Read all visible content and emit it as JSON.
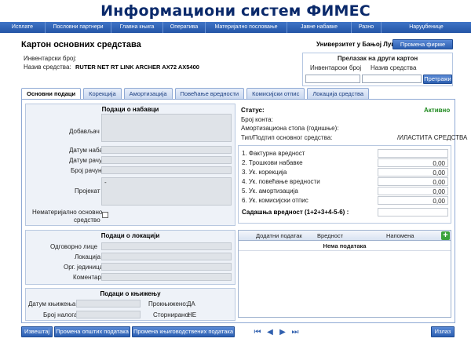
{
  "app": {
    "title": "Информациони систем ФИМЕС"
  },
  "menu": [
    "Исплате",
    "Пословни партнери",
    "Главна књига",
    "Оперативa",
    "Материјално пословање",
    "Јавне набавке",
    "Разно",
    "Наруџбенице"
  ],
  "page": {
    "title": "Картон основних средстава",
    "inventory_label": "Инвентарски број:",
    "inventory_value": "",
    "name_label": "Назив средства:",
    "name_value": "RUTER NET RT LINK ARCHER AX72 AX5400"
  },
  "firm": {
    "name": "Универзитет у Бањој Луци",
    "change_button": "Промена фирме"
  },
  "transfer": {
    "title": "Прелазак на други картон",
    "inv_label": "Инвентарски број",
    "name_label": "Назив средства",
    "inv_value": "",
    "name_value": "",
    "search_button": "Претражи"
  },
  "tabs": [
    "Основни подаци",
    "Корекција",
    "Амортизација",
    "Повећање вредности",
    "Комисијски отпис",
    "Локација средства"
  ],
  "acquisition": {
    "header": "Подаци о набавци",
    "supplier_label": "Добављач",
    "date_label": "Датум набавке",
    "invoice_date_label": "Датум рачуна",
    "invoice_no_label": "Број рачуна",
    "project_label": "Пројекат",
    "project_value": "-",
    "intangible_label_1": "Нематеријално основно",
    "intangible_label_2": "средство"
  },
  "location": {
    "header": "Подаци о локацији",
    "responsible_label": "Одговорно лице",
    "location_label": "Локација",
    "org_unit_label": "Орг. јединица",
    "comment_label": "Коментар"
  },
  "booking": {
    "header": "Подаци о књижењу",
    "date_label": "Датум књижења",
    "order_label": "Број налога",
    "booked_label": "Прокњижено:",
    "booked_value": "ДА",
    "cancelled_label": "Сторнирано:",
    "cancelled_value": "НЕ"
  },
  "status": {
    "status_label": "Статус:",
    "status_value": "Активно",
    "account_label": "Број конта:",
    "depreciation_label": "Амортизациона стопа (годишње):",
    "type_label": "Тип/Подтип основног средства:",
    "type_value": "/ИЛАСТИТА СРЕДСТВА"
  },
  "values": {
    "rows": [
      {
        "label": "1. Фактурна вредност",
        "value": ""
      },
      {
        "label": "2. Трошкови набавке",
        "value": "0,00"
      },
      {
        "label": "3. Ук. корекција",
        "value": "0,00"
      },
      {
        "label": "4. Ук. повећање вредности",
        "value": "0,00"
      },
      {
        "label": "5. Ук. амортизација",
        "value": "0,00"
      },
      {
        "label": "6. Ук. комисијски отпис",
        "value": "0,00"
      }
    ],
    "current_label": "Садашња вредност (1+2+3+4-5-6) :"
  },
  "extra_grid": {
    "col1": "Додатни податак",
    "col2": "Вредност",
    "col3": "Напомена",
    "empty": "Нема података"
  },
  "footer": {
    "report_button": "Извештај",
    "general_button": "Промена општих података",
    "accounting_button": "Промена књиговодствених података",
    "exit_button": "Излаз"
  },
  "colors": {
    "accent": "#2c5fb1",
    "title": "#0b2a6b",
    "active_status": "#1f8a1f"
  }
}
